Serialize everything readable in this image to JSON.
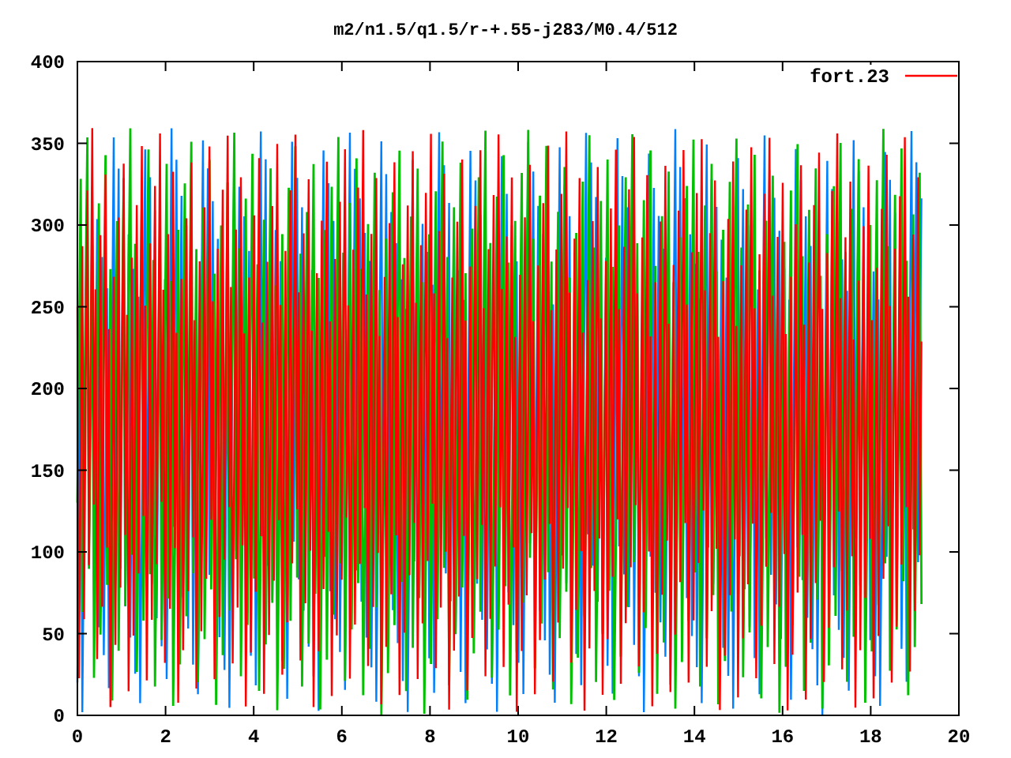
{
  "title": "m2/n1.5/q1.5/r-+.55-j283/M0.4/512",
  "legend": {
    "label": "fort.23"
  },
  "x_axis": {
    "ticks": [
      "0",
      "2",
      "4",
      "6",
      "8",
      "10",
      "12",
      "14",
      "16",
      "18",
      "20"
    ]
  },
  "y_axis": {
    "ticks": [
      "400",
      "350",
      "300",
      "250",
      "200",
      "150",
      "100",
      "50",
      "0"
    ]
  }
}
